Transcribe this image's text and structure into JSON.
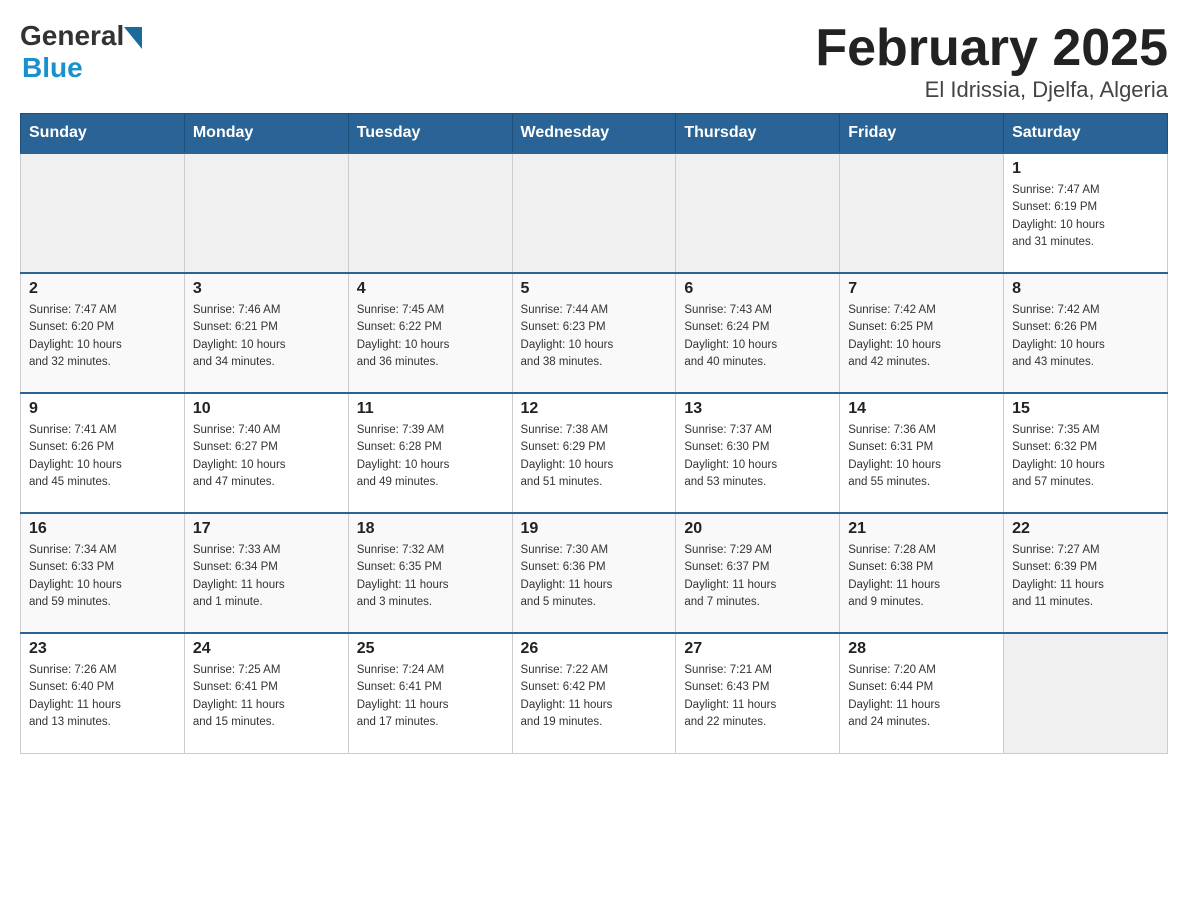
{
  "header": {
    "logo_general": "General",
    "logo_blue": "Blue",
    "title": "February 2025",
    "subtitle": "El Idrissia, Djelfa, Algeria"
  },
  "days_of_week": [
    "Sunday",
    "Monday",
    "Tuesday",
    "Wednesday",
    "Thursday",
    "Friday",
    "Saturday"
  ],
  "weeks": [
    [
      {
        "day": "",
        "info": ""
      },
      {
        "day": "",
        "info": ""
      },
      {
        "day": "",
        "info": ""
      },
      {
        "day": "",
        "info": ""
      },
      {
        "day": "",
        "info": ""
      },
      {
        "day": "",
        "info": ""
      },
      {
        "day": "1",
        "info": "Sunrise: 7:47 AM\nSunset: 6:19 PM\nDaylight: 10 hours\nand 31 minutes."
      }
    ],
    [
      {
        "day": "2",
        "info": "Sunrise: 7:47 AM\nSunset: 6:20 PM\nDaylight: 10 hours\nand 32 minutes."
      },
      {
        "day": "3",
        "info": "Sunrise: 7:46 AM\nSunset: 6:21 PM\nDaylight: 10 hours\nand 34 minutes."
      },
      {
        "day": "4",
        "info": "Sunrise: 7:45 AM\nSunset: 6:22 PM\nDaylight: 10 hours\nand 36 minutes."
      },
      {
        "day": "5",
        "info": "Sunrise: 7:44 AM\nSunset: 6:23 PM\nDaylight: 10 hours\nand 38 minutes."
      },
      {
        "day": "6",
        "info": "Sunrise: 7:43 AM\nSunset: 6:24 PM\nDaylight: 10 hours\nand 40 minutes."
      },
      {
        "day": "7",
        "info": "Sunrise: 7:42 AM\nSunset: 6:25 PM\nDaylight: 10 hours\nand 42 minutes."
      },
      {
        "day": "8",
        "info": "Sunrise: 7:42 AM\nSunset: 6:26 PM\nDaylight: 10 hours\nand 43 minutes."
      }
    ],
    [
      {
        "day": "9",
        "info": "Sunrise: 7:41 AM\nSunset: 6:26 PM\nDaylight: 10 hours\nand 45 minutes."
      },
      {
        "day": "10",
        "info": "Sunrise: 7:40 AM\nSunset: 6:27 PM\nDaylight: 10 hours\nand 47 minutes."
      },
      {
        "day": "11",
        "info": "Sunrise: 7:39 AM\nSunset: 6:28 PM\nDaylight: 10 hours\nand 49 minutes."
      },
      {
        "day": "12",
        "info": "Sunrise: 7:38 AM\nSunset: 6:29 PM\nDaylight: 10 hours\nand 51 minutes."
      },
      {
        "day": "13",
        "info": "Sunrise: 7:37 AM\nSunset: 6:30 PM\nDaylight: 10 hours\nand 53 minutes."
      },
      {
        "day": "14",
        "info": "Sunrise: 7:36 AM\nSunset: 6:31 PM\nDaylight: 10 hours\nand 55 minutes."
      },
      {
        "day": "15",
        "info": "Sunrise: 7:35 AM\nSunset: 6:32 PM\nDaylight: 10 hours\nand 57 minutes."
      }
    ],
    [
      {
        "day": "16",
        "info": "Sunrise: 7:34 AM\nSunset: 6:33 PM\nDaylight: 10 hours\nand 59 minutes."
      },
      {
        "day": "17",
        "info": "Sunrise: 7:33 AM\nSunset: 6:34 PM\nDaylight: 11 hours\nand 1 minute."
      },
      {
        "day": "18",
        "info": "Sunrise: 7:32 AM\nSunset: 6:35 PM\nDaylight: 11 hours\nand 3 minutes."
      },
      {
        "day": "19",
        "info": "Sunrise: 7:30 AM\nSunset: 6:36 PM\nDaylight: 11 hours\nand 5 minutes."
      },
      {
        "day": "20",
        "info": "Sunrise: 7:29 AM\nSunset: 6:37 PM\nDaylight: 11 hours\nand 7 minutes."
      },
      {
        "day": "21",
        "info": "Sunrise: 7:28 AM\nSunset: 6:38 PM\nDaylight: 11 hours\nand 9 minutes."
      },
      {
        "day": "22",
        "info": "Sunrise: 7:27 AM\nSunset: 6:39 PM\nDaylight: 11 hours\nand 11 minutes."
      }
    ],
    [
      {
        "day": "23",
        "info": "Sunrise: 7:26 AM\nSunset: 6:40 PM\nDaylight: 11 hours\nand 13 minutes."
      },
      {
        "day": "24",
        "info": "Sunrise: 7:25 AM\nSunset: 6:41 PM\nDaylight: 11 hours\nand 15 minutes."
      },
      {
        "day": "25",
        "info": "Sunrise: 7:24 AM\nSunset: 6:41 PM\nDaylight: 11 hours\nand 17 minutes."
      },
      {
        "day": "26",
        "info": "Sunrise: 7:22 AM\nSunset: 6:42 PM\nDaylight: 11 hours\nand 19 minutes."
      },
      {
        "day": "27",
        "info": "Sunrise: 7:21 AM\nSunset: 6:43 PM\nDaylight: 11 hours\nand 22 minutes."
      },
      {
        "day": "28",
        "info": "Sunrise: 7:20 AM\nSunset: 6:44 PM\nDaylight: 11 hours\nand 24 minutes."
      },
      {
        "day": "",
        "info": ""
      }
    ]
  ]
}
